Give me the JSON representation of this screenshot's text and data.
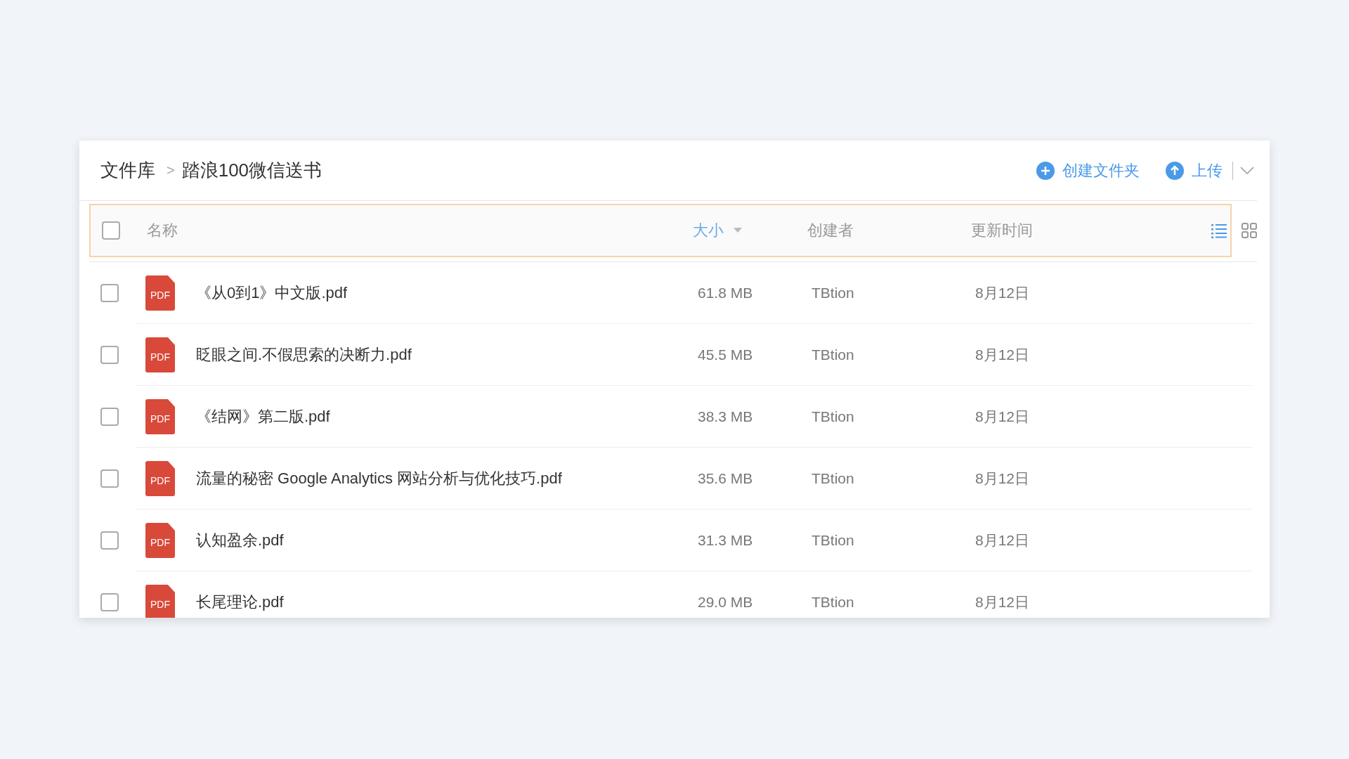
{
  "breadcrumb": [
    {
      "label": "文件库"
    },
    {
      "label": "踏浪100微信送书"
    }
  ],
  "breadcrumb_separator": ">",
  "actions": [
    {
      "kind": "create",
      "label": "创建文件夹"
    },
    {
      "kind": "upload",
      "label": "上传"
    }
  ],
  "columns": [
    {
      "label": "名称",
      "sorted": false
    },
    {
      "label": "大小",
      "sorted": true
    },
    {
      "label": "创建者",
      "sorted": false
    },
    {
      "label": "更新时间",
      "sorted": false
    }
  ],
  "header_checked": false,
  "view_modes": [
    {
      "kind": "list",
      "selected": true
    },
    {
      "kind": "grid",
      "selected": false
    }
  ],
  "rows": [
    {
      "checked": false,
      "icon_label": "PDF",
      "name": "《从0到1》中文版.pdf",
      "size": "61.8 MB",
      "creator": "TBtion",
      "updated": "8月12日"
    },
    {
      "checked": false,
      "icon_label": "PDF",
      "name": "眨眼之间.不假思索的决断力.pdf",
      "size": "45.5 MB",
      "creator": "TBtion",
      "updated": "8月12日"
    },
    {
      "checked": false,
      "icon_label": "PDF",
      "name": "《结网》第二版.pdf",
      "size": "38.3 MB",
      "creator": "TBtion",
      "updated": "8月12日"
    },
    {
      "checked": false,
      "icon_label": "PDF",
      "name": "流量的秘密 Google Analytics 网站分析与优化技巧.pdf",
      "size": "35.6 MB",
      "creator": "TBtion",
      "updated": "8月12日"
    },
    {
      "checked": false,
      "icon_label": "PDF",
      "name": "认知盈余.pdf",
      "size": "31.3 MB",
      "creator": "TBtion",
      "updated": "8月12日"
    },
    {
      "checked": false,
      "icon_label": "PDF",
      "name": "长尾理论.pdf",
      "size": "29.0 MB",
      "creator": "TBtion",
      "updated": "8月12日"
    }
  ]
}
